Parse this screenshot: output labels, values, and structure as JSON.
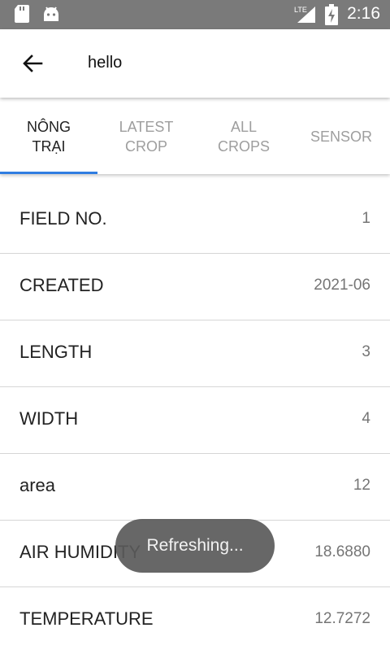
{
  "status_bar": {
    "time": "2:16",
    "icons": [
      "sd-card-icon",
      "android-icon",
      "lte-signal-icon",
      "battery-charging-icon"
    ],
    "network_label": "LTE"
  },
  "app_bar": {
    "title": "hello",
    "back_icon": "arrow-back-icon"
  },
  "tabs": [
    {
      "label": "NÔNG\nTRẠI",
      "active": true
    },
    {
      "label": "LATEST\nCROP",
      "active": false
    },
    {
      "label": "ALL\nCROPS",
      "active": false
    },
    {
      "label": "SENSOR",
      "active": false
    }
  ],
  "fields": [
    {
      "label": "FIELD NO.",
      "value": "1"
    },
    {
      "label": "CREATED",
      "value": "2021-06"
    },
    {
      "label": "LENGTH",
      "value": "3"
    },
    {
      "label": "WIDTH",
      "value": "4"
    },
    {
      "label": "area",
      "value": "12"
    },
    {
      "label": "AIR HUMIDITY",
      "value": "18.6880"
    },
    {
      "label": "TEMPERATURE",
      "value": "12.7272"
    }
  ],
  "toast": {
    "message": "Refreshing..."
  },
  "colors": {
    "status_bar_bg": "#7a7a7a",
    "tab_indicator": "#2f7de1",
    "active_tab_text": "#222222",
    "inactive_tab_text": "#9e9e9e"
  }
}
